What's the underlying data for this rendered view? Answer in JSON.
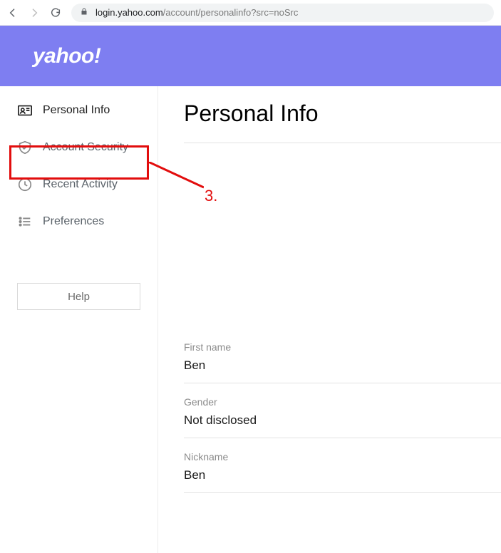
{
  "browser": {
    "url_host": "login.yahoo.com",
    "url_path": "/account/personalinfo?src=noSrc"
  },
  "header": {
    "logo_text": "yahoo!"
  },
  "sidebar": {
    "items": [
      {
        "label": "Personal Info",
        "icon": "id-card-icon",
        "active": true
      },
      {
        "label": "Account Security",
        "icon": "shield-check-icon",
        "active": false
      },
      {
        "label": "Recent Activity",
        "icon": "clock-icon",
        "active": false
      },
      {
        "label": "Preferences",
        "icon": "list-icon",
        "active": false
      }
    ],
    "help_label": "Help"
  },
  "main": {
    "title": "Personal Info",
    "fields": [
      {
        "label": "First name",
        "value": "Ben"
      },
      {
        "label": "Gender",
        "value": "Not disclosed"
      },
      {
        "label": "Nickname",
        "value": "Ben"
      }
    ]
  },
  "annotation": {
    "label": "3."
  }
}
